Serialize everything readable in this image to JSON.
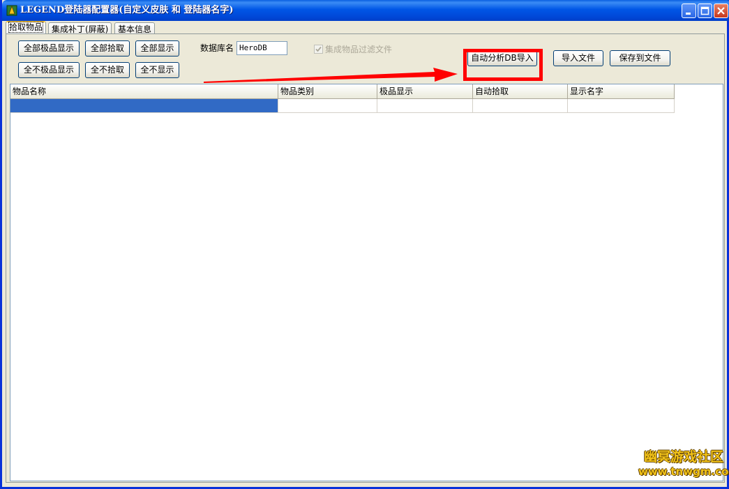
{
  "window": {
    "title": "LEGEND登陆器配置器(自定义皮肤 和 登陆器名字)",
    "icon": "app-icon"
  },
  "tabs": [
    {
      "label": "拾取物品",
      "active": true
    },
    {
      "label": "集成补丁(屏蔽)",
      "active": false
    },
    {
      "label": "基本信息",
      "active": false
    }
  ],
  "toolbar": {
    "buttons": [
      "全部极品显示",
      "全部拾取",
      "全部显示",
      "全不极品显示",
      "全不拾取",
      "全不显示"
    ],
    "db_label": "数据库名",
    "db_value": "HeroDB",
    "filter_checkbox_label": "集成物品过滤文件",
    "filter_checked": true,
    "auto_import_label": "自动分析DB导入",
    "import_file_label": "导入文件",
    "save_file_label": "保存到文件"
  },
  "grid": {
    "columns": [
      "物品名称",
      "物品类别",
      "极品显示",
      "自动拾取",
      "显示名字"
    ],
    "rows": [
      [
        "",
        "",
        "",
        "",
        ""
      ]
    ],
    "selection_color": "#316AC5"
  },
  "annotation": {
    "color": "#FF0000"
  },
  "watermark": {
    "title": "幽冥游戏社区",
    "url": "www.tnwgm.com"
  }
}
